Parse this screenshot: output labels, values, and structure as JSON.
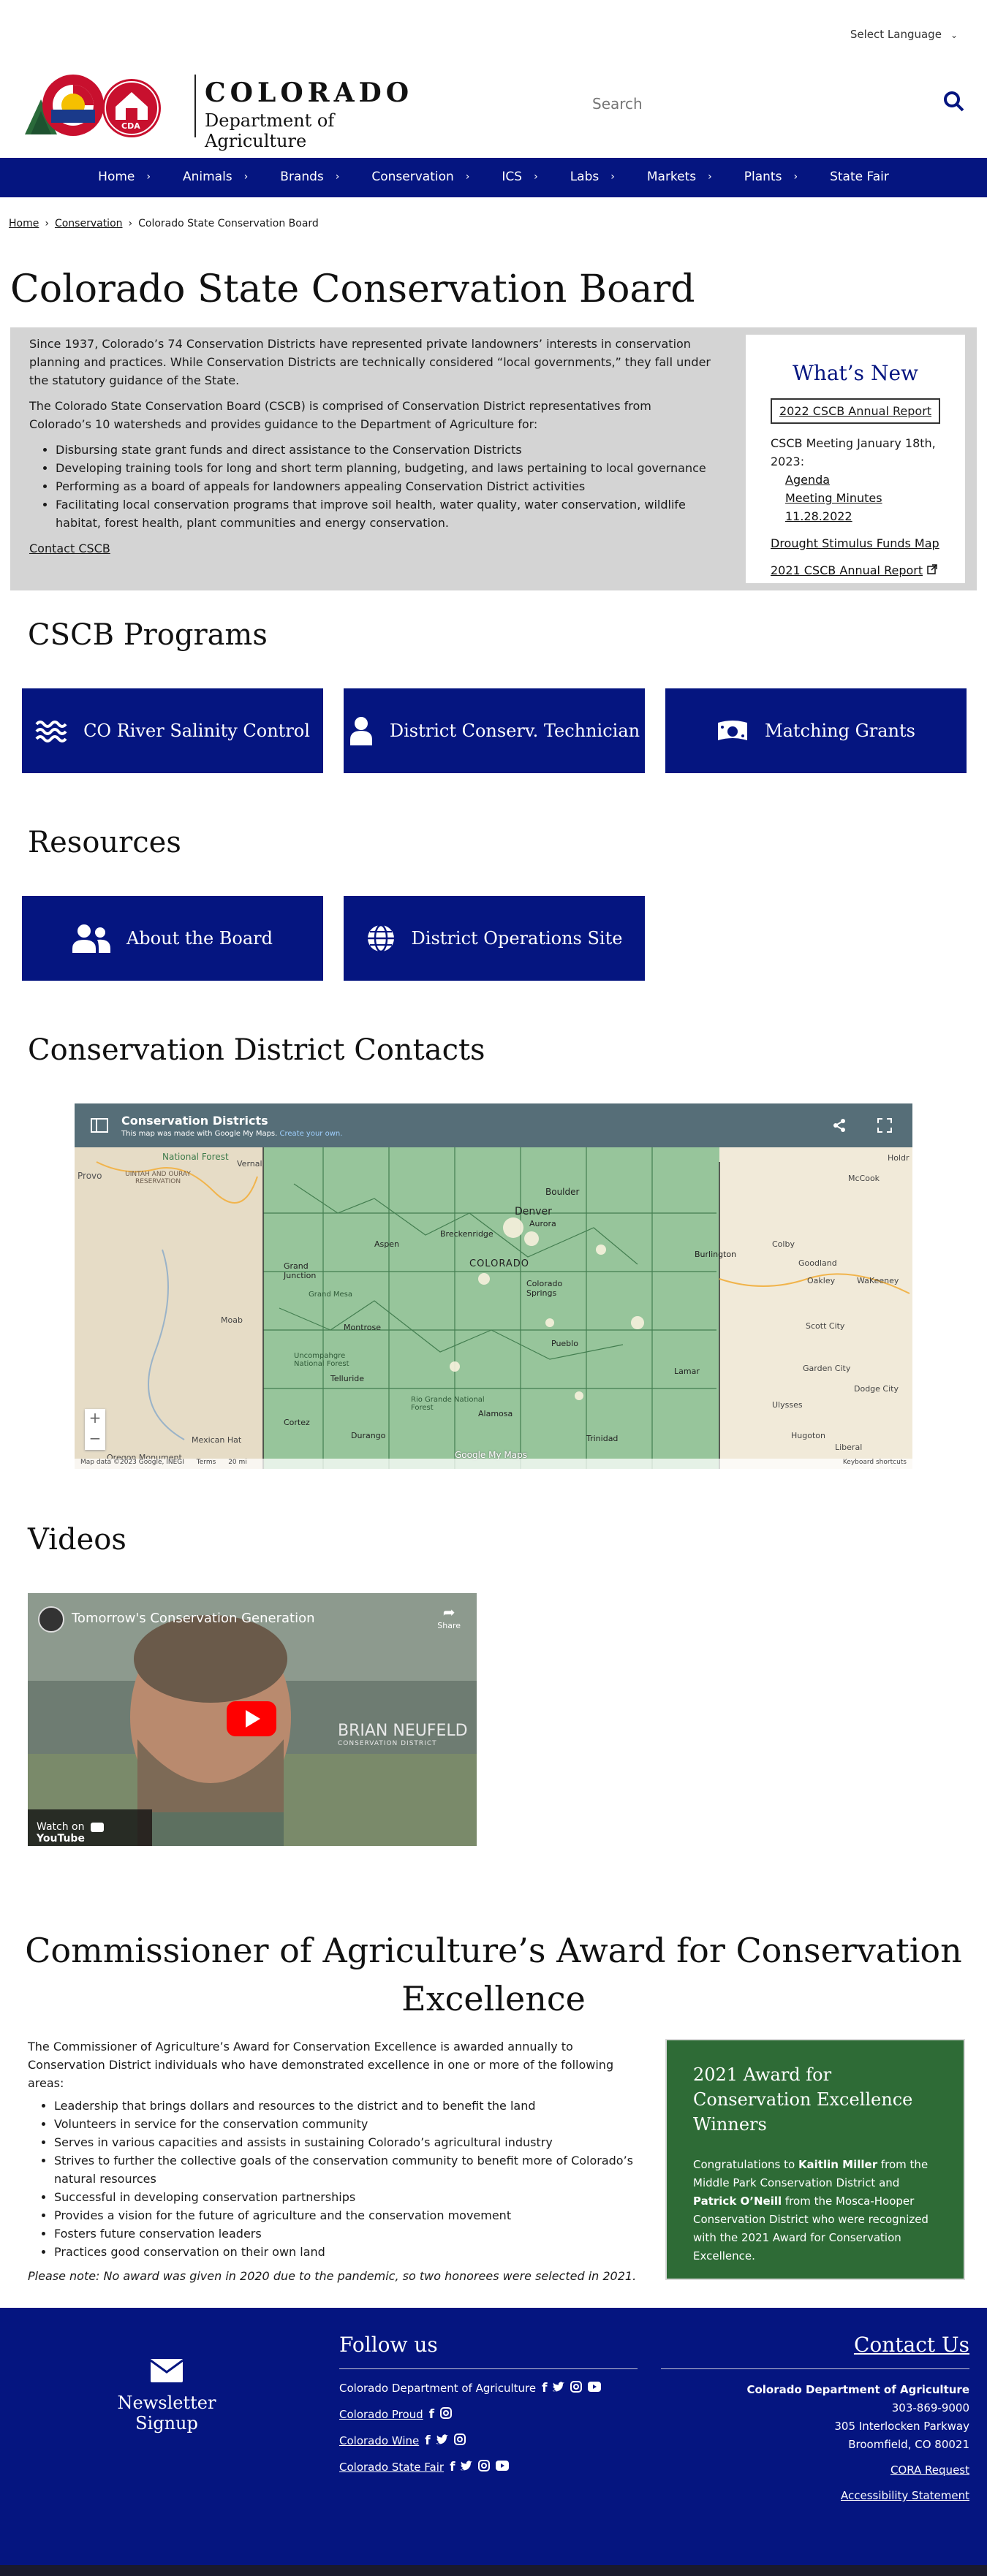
{
  "language": {
    "label": "Select Language"
  },
  "brand": {
    "line1": "COLORADO",
    "line2": "Department of Agriculture",
    "cda": "CDA"
  },
  "search": {
    "placeholder": "Search"
  },
  "nav": [
    "Home",
    "Animals",
    "Brands",
    "Conservation",
    "ICS",
    "Labs",
    "Markets",
    "Plants",
    "State Fair"
  ],
  "breadcrumb": {
    "home": "Home",
    "conservation": "Conservation",
    "current": "Colorado State Conservation Board"
  },
  "page_title": "Colorado State Conservation Board",
  "intro": {
    "p1": "Since 1937, Colorado’s 74 Conservation Districts have represented private landowners’ interests in conservation planning and practices. While Conservation Districts are technically considered “local governments,” they fall under the statutory guidance of the State.",
    "p2": "The Colorado State Conservation Board (CSCB) is comprised of Conservation District representatives from Colorado’s 10 watersheds and provides guidance to the Department of Agriculture for:",
    "bullets": [
      "Disbursing state grant funds and direct assistance to the Conservation Districts",
      "Developing training tools for long and short term planning, budgeting, and laws pertaining to local governance",
      "Performing as a board of appeals for landowners appealing Conservation District activities",
      "Facilitating local conservation programs that improve soil health, water quality, water conservation, wildlife habitat, forest health, plant communities and energy conservation."
    ],
    "contact_link": "Contact CSCB"
  },
  "whats_new": {
    "title": "What’s New",
    "report_button": "2022 CSCB Annual Report",
    "meeting": "CSCB Meeting January 18th, 2023:",
    "agenda": "Agenda",
    "minutes": "Meeting Minutes 11.28.2022",
    "drought": "Drought Stimulus Funds Map",
    "report2021": "2021 CSCB Annual Report"
  },
  "programs": {
    "title": "CSCB Programs",
    "cards": [
      "CO River Salinity Control",
      "District Conserv. Technician",
      "Matching Grants"
    ]
  },
  "resources": {
    "title": "Resources",
    "cards": [
      "About the Board",
      "District Operations Site"
    ]
  },
  "contacts": {
    "title": "Conservation District Contacts",
    "map_title": "Conservation Districts",
    "map_sub1": "This map was made with Google My Maps.",
    "map_sub2": "Create your own.",
    "map_labels": [
      "Provo",
      "UINTAH AND OURAY RESERVATION",
      "National Forest",
      "Vernal",
      "Boulder",
      "Denver",
      "Aurora",
      "McCook",
      "Holdr",
      "Grand Junction",
      "COLORADO",
      "Colorado Springs",
      "Burlington",
      "Goodland",
      "Colby",
      "Oakley",
      "WaKeeney",
      "Moab",
      "Pueblo",
      "Scott City",
      "Garden City",
      "Dodge City",
      "Ulysses",
      "Liberal",
      "Hugoton",
      "Durango",
      "Cortez",
      "Alamosa",
      "Montrose",
      "Mexican Hat",
      "Telluride",
      "Aspen",
      "Breckenridge",
      "Lamar",
      "Trinidad",
      "Oregon Monument",
      "Rio Grande National Forest",
      "Uncompahgre National Forest",
      "Grand Mesa"
    ],
    "map_footer": "Map data ©2023 Google, INEGI",
    "map_terms": "Terms",
    "map_scale": "20 mi",
    "map_shortcuts": "Keyboard shortcuts",
    "map_logo": "Google My Maps"
  },
  "videos": {
    "title": "Videos",
    "video_title": "Tomorrow's Conservation Generation",
    "share": "Share",
    "name_overlay": "BRIAN NEUFELD",
    "name_sub": "CONSERVATION DISTRICT",
    "watch_on": "Watch on",
    "youtube": "YouTube"
  },
  "award": {
    "title": "Commissioner of Agriculture’s Award for Conservation Excellence",
    "intro": "The Commissioner of Agriculture’s Award for Conservation Excellence is awarded annually to Conservation District individuals who have demonstrated excellence in one or more of the following areas:",
    "bullets": [
      "Leadership that brings dollars and resources to the district and to benefit the land",
      "Volunteers in service for the conservation community",
      "Serves in various capacities and assists in sustaining Colorado’s agricultural industry",
      "Strives to further the collective goals of the conservation community to benefit more of Colorado’s natural resources",
      "Successful in developing conservation partnerships",
      "Provides a vision for the future of agriculture and the conservation movement",
      "Fosters future conservation leaders",
      "Practices good conservation on their own land"
    ],
    "note": "Please note: No award was given in 2020 due to the pandemic, so two honorees were selected in 2021.",
    "box_title": "2021 Award for Conservation Excellence Winners",
    "box_p1": "Congratulations to ",
    "winner1": "Kaitlin Miller",
    "box_p2": " from the Middle Park Conservation District and ",
    "winner2": "Patrick O’Neill",
    "box_p3": " from the Mosca-Hooper Conservation District who were recognized with the 2021 Award for Conservation Excellence."
  },
  "footer": {
    "newsletter": "Newsletter Signup",
    "follow_title": "Follow us",
    "follow_rows": [
      "Colorado Department of Agriculture",
      "Colorado Proud",
      "Colorado Wine",
      "Colorado State Fair"
    ],
    "contact_title": "Contact Us",
    "org": "Colorado Department of Agriculture",
    "phone": "303-869-9000",
    "address1": "305 Interlocken Parkway",
    "address2": "Broomfield, CO 80021",
    "cora": "CORA Request",
    "access": "Accessibility Statement"
  },
  "colors": {
    "navy": "#051580",
    "green": "#2e6b36",
    "gray_panel": "#d4d4d4",
    "map_green": "#4fa866"
  }
}
